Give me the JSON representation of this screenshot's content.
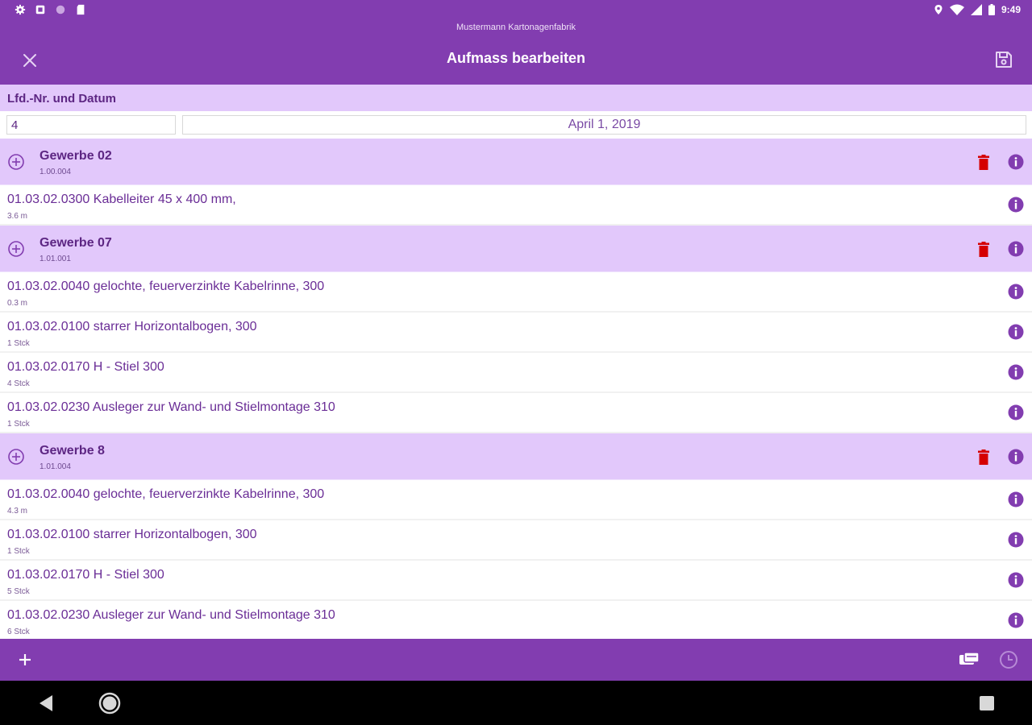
{
  "status_bar": {
    "time": "9:49",
    "left_icons": [
      "settings-icon",
      "notification-icon",
      "circle-icon",
      "sd-card-icon"
    ],
    "right_icons": [
      "location-icon",
      "wifi-icon",
      "signal-icon",
      "battery-icon"
    ]
  },
  "app_bar": {
    "company": "Mustermann Kartonagenfabrik",
    "title": "Aufmass bearbeiten",
    "close_icon": "close-icon",
    "save_icon": "save-icon"
  },
  "header_section": {
    "label": "Lfd.-Nr. und Datum",
    "number_value": "4",
    "date_value": "April 1, 2019"
  },
  "groups": [
    {
      "title": "Gewerbe 02",
      "subtitle": "1.00.004",
      "items": [
        {
          "title": "01.03.02.0300 Kabelleiter 45 x 400 mm,",
          "subtitle": "3.6 m"
        }
      ]
    },
    {
      "title": "Gewerbe 07",
      "subtitle": "1.01.001",
      "items": [
        {
          "title": "01.03.02.0040 gelochte, feuerverzinkte Kabelrinne, 300",
          "subtitle": "0.3 m"
        },
        {
          "title": "01.03.02.0100 starrer Horizontalbogen, 300",
          "subtitle": "1 Stck"
        },
        {
          "title": "01.03.02.0170 H - Stiel 300",
          "subtitle": "4 Stck"
        },
        {
          "title": "01.03.02.0230 Ausleger zur Wand- und Stielmontage 310",
          "subtitle": "1 Stck"
        }
      ]
    },
    {
      "title": "Gewerbe 8",
      "subtitle": "1.01.004",
      "items": [
        {
          "title": "01.03.02.0040 gelochte, feuerverzinkte Kabelrinne, 300",
          "subtitle": "4.3 m"
        },
        {
          "title": "01.03.02.0100 starrer Horizontalbogen, 300",
          "subtitle": "1 Stck"
        },
        {
          "title": "01.03.02.0170 H - Stiel 300",
          "subtitle": "5 Stck"
        },
        {
          "title": "01.03.02.0230 Ausleger zur Wand- und Stielmontage 310",
          "subtitle": "6 Stck"
        }
      ]
    }
  ],
  "bottom_bar": {
    "icons": [
      "add-icon",
      "cards-icon",
      "clock-icon"
    ]
  },
  "colors": {
    "primary": "#823db0",
    "group_background": "#e2c8fb",
    "text": "#5d2683",
    "delete": "#d50000"
  }
}
